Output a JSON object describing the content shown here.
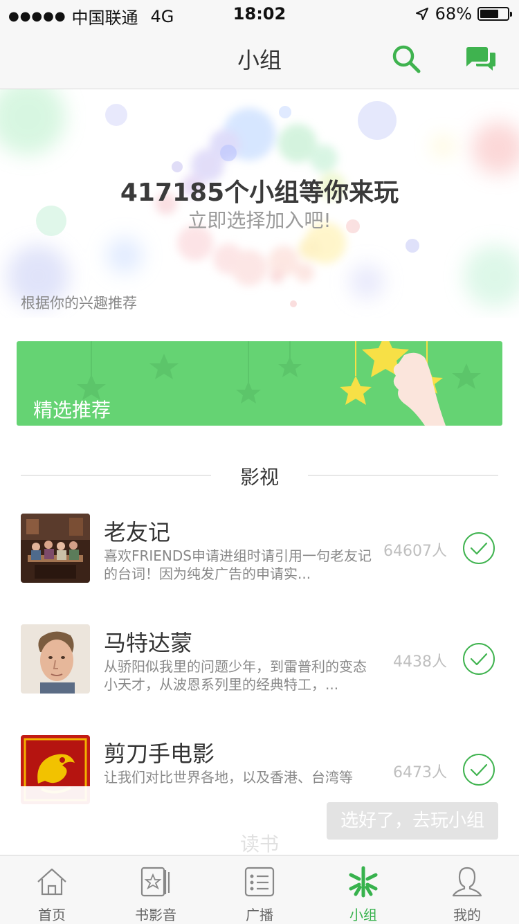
{
  "status_bar": {
    "signal_dots": "●●●●●",
    "carrier": "中国联通",
    "network": "4G",
    "time": "18:02",
    "battery": "68%",
    "battery_level": 0.68
  },
  "nav": {
    "title": "小组",
    "search_icon": "search-icon",
    "chat_icon": "chat-bubbles-icon",
    "accent": "#3fb34f"
  },
  "hero": {
    "title": "417185个小组等你来玩",
    "subtitle": "立即选择加入吧!",
    "hint": "根据你的兴趣推荐"
  },
  "banner": {
    "label": "精选推荐",
    "color": "#65d373"
  },
  "section": {
    "title": "影视",
    "next_title": "读书"
  },
  "groups": [
    {
      "name": "老友记",
      "desc": "喜欢FRIENDS申请进组时请引用一句老友记的台词！因为纯发广告的申请实...",
      "count": "64607人"
    },
    {
      "name": "马特达蒙",
      "desc": "从骄阳似我里的问题少年，到雷普利的变态小天才，从波恩系列里的经典特工，...",
      "count": "4438人"
    },
    {
      "name": "剪刀手电影",
      "desc": "让我们对比世界各地，以及香港、台湾等",
      "count": "6473人"
    }
  ],
  "action": {
    "button_label": "选好了，去玩小组"
  },
  "tabs": [
    {
      "label": "首页",
      "icon": "home-icon"
    },
    {
      "label": "书影音",
      "icon": "media-icon"
    },
    {
      "label": "广播",
      "icon": "broadcast-icon"
    },
    {
      "label": "小组",
      "icon": "groups-icon",
      "active": true
    },
    {
      "label": "我的",
      "icon": "profile-icon"
    }
  ]
}
